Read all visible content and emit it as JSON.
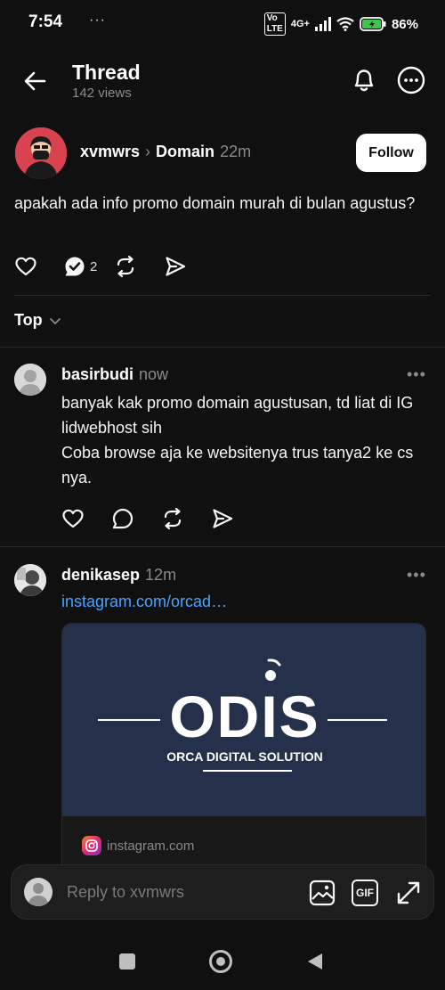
{
  "status_bar": {
    "time": "7:54",
    "dots": "···",
    "battery_percent": "86%",
    "network": "4G+"
  },
  "header": {
    "title": "Thread",
    "views": "142 views"
  },
  "post": {
    "author": "xvmwrs",
    "separator": "›",
    "topic": "Domain",
    "time": "22m",
    "follow_label": "Follow",
    "text": "apakah ada info promo domain murah di bulan agustus?",
    "reply_count": "2"
  },
  "sort": {
    "label": "Top"
  },
  "replies": [
    {
      "author": "basirbudi",
      "time": "now",
      "text_line1": "banyak kak promo domain agustusan, td liat di IG lidwebhost sih",
      "text_line2": "Coba browse aja ke websitenya trus tanya2 ke cs nya."
    },
    {
      "author": "denikasep",
      "time": "12m",
      "link": "instagram.com/orcad…",
      "preview": {
        "logo_text": "ODIS",
        "tagline": "ORCA DIGITAL SOLUTION",
        "domain": "instagram.com"
      }
    }
  ],
  "more_label": "•••",
  "reply_bar": {
    "placeholder": "Reply to xvmwrs",
    "gif_label": "GIF"
  },
  "colors": {
    "background": "#101010",
    "link": "#4aa3ff",
    "muted": "#8a8a8a",
    "avatar_main": "#d8434f",
    "preview_bg": "#25304a"
  }
}
